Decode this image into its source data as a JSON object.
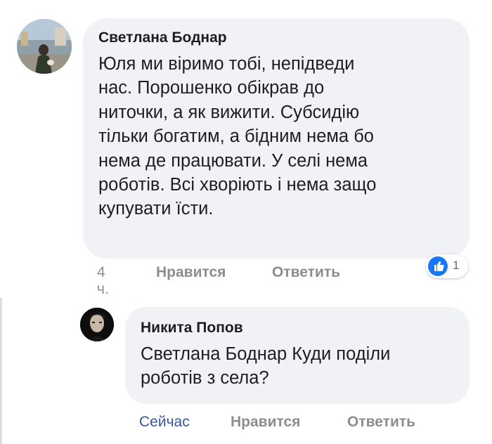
{
  "comments": [
    {
      "author": "Светлана Боднар",
      "lines": [
        "Юля ми віримо тобі, непідведи",
        "нас. Порошенко обікрав до",
        "ниточки, а як вижити. Субсидію",
        "тільки богатим, а бідним нема бо",
        "нема де працювати. У селі нема",
        "роботів. Всі хворіють і нема защо",
        "купувати їсти."
      ],
      "time": "4 ч.",
      "like_label": "Нравится",
      "reply_label": "Ответить",
      "reaction_count": "1",
      "reaction_icon": "thumbs-up-icon",
      "reaction_color": "#1877f2"
    },
    {
      "author": "Никита Попов",
      "lines": [
        "Светлана Боднар Куди поділи",
        "роботів з села?"
      ],
      "time": "Сейчас",
      "like_label": "Нравится",
      "reply_label": "Ответить"
    }
  ],
  "colors": {
    "bubble": "#f0f2f5",
    "meta_text": "#8a8d91",
    "time_link": "#385898",
    "text": "#1c1e21"
  }
}
